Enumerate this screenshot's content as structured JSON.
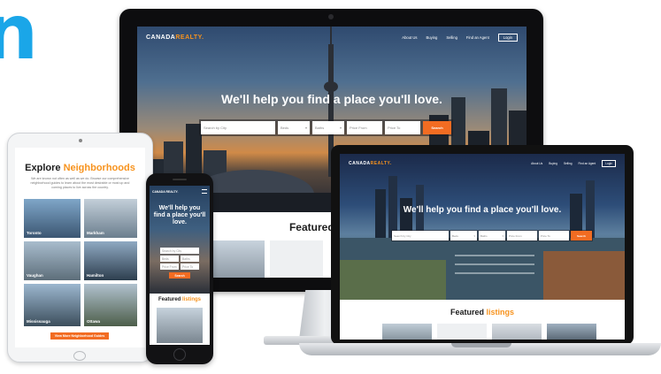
{
  "edge_glyph": "n",
  "brand": {
    "name_main": "CANADA",
    "name_accent": "REALTY",
    "dot": ".",
    "accent_color": "#f7931e",
    "button_color": "#f26c22"
  },
  "nav": {
    "about": "About Us",
    "buying": "Buying",
    "selling": "Selling",
    "find_agent": "Find an Agent",
    "login": "Login"
  },
  "hero": {
    "title": "We'll help you find a place you'll love."
  },
  "search": {
    "city": "Search by City",
    "beds": "Beds",
    "baths": "Baths",
    "price_from": "Price From",
    "price_to": "Price To",
    "button": "Search"
  },
  "featured": {
    "word": "Featured",
    "accent": "listings"
  },
  "tablet": {
    "title_main": "Explore",
    "title_accent": "Neighborhoods",
    "description": "We are known not often as well as we do. Browse our comprehensive neighborhood guides to learn about the most desirable or most up and coming places to live across the country.",
    "cities": [
      "Toronto",
      "Markham",
      "Vaughan",
      "Hamilton",
      "Mississauga",
      "Ottawa"
    ],
    "cta": "View More Neighborhood Guides"
  },
  "phone": {
    "logo": "CANADA REALTY.",
    "title": "We'll help you find a place you'll love."
  }
}
